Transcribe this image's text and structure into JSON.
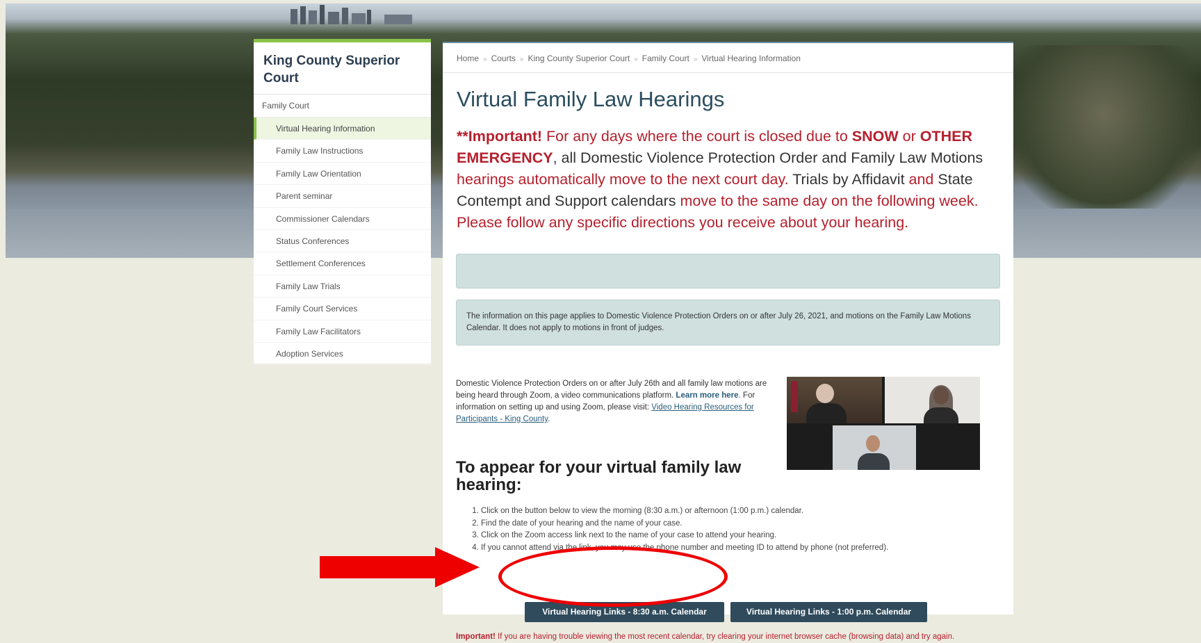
{
  "sidebar": {
    "title": "King County Superior Court",
    "parent": "Family Court",
    "items": [
      "Virtual Hearing Information",
      "Family Law Instructions",
      "Family Law Orientation",
      "Parent seminar",
      "Commissioner Calendars",
      "Status Conferences",
      "Settlement Conferences",
      "Family Law Trials",
      "Family Court Services",
      "Family Law Facilitators",
      "Adoption Services"
    ]
  },
  "breadcrumb": [
    "Home",
    "Courts",
    "King County Superior Court",
    "Family Court",
    "Virtual Hearing Information"
  ],
  "page_title": "Virtual Family Law Hearings",
  "important": {
    "prefix": "**Important!",
    "t1": " For any days where the court is closed due to ",
    "snow": "SNOW",
    "t2": " or ",
    "other": "OTHER EMERGENCY",
    "t3": ", all Domestic Violence Protection Order and Family Law Motions",
    "t4": " hearings automatically move to the next court day.",
    "t5": "  Trials by Affidavit",
    "t6": " and ",
    "t7": "State Contempt and Support calendars",
    "t8": " move to the same day on the following week.  Please follow any specific directions you receive about your hearing."
  },
  "callout": "The information on this page applies to Domestic Violence Protection Orders on or after July 26, 2021, and motions on the Family Law Motions Calendar.  It does not apply to motions in front of judges.",
  "zoom_text": {
    "t1": "Domestic Violence Protection Orders on or after July 26th and all family law motions are being heard through Zoom, a video communications platform. ",
    "learn_more": "Learn more here",
    "t2": ". For information on setting up and using Zoom, please visit: ",
    "link": "Video Hearing Resources for Participants - King County",
    "t3": "."
  },
  "appear_heading": "To appear for your virtual family law hearing:",
  "steps": [
    "Click on the button below to view the morning (8:30 a.m.) or afternoon (1:00 p.m.) calendar.",
    "Find the date of your hearing and the name of your case.",
    "Click on the Zoom access link next to the name of your case to attend your hearing.",
    "If you cannot attend via the link, you may use the phone number and meeting ID to attend by phone (not preferred)."
  ],
  "buttons": {
    "morning": "Virtual Hearing Links - 8:30 a.m. Calendar",
    "afternoon": "Virtual Hearing Links - 1:00 p.m. Calendar"
  },
  "note": {
    "bold": "Important!",
    "text": " If you are having trouble viewing the most recent calendar, try clearing your internet browser cache (browsing data) and try again."
  },
  "colors": {
    "accent_green": "#8bc34a",
    "alert_red": "#b5202d",
    "button_bg": "#2f4b5c",
    "callout_bg": "#cfe0df",
    "annotation_red": "#ee0000"
  }
}
